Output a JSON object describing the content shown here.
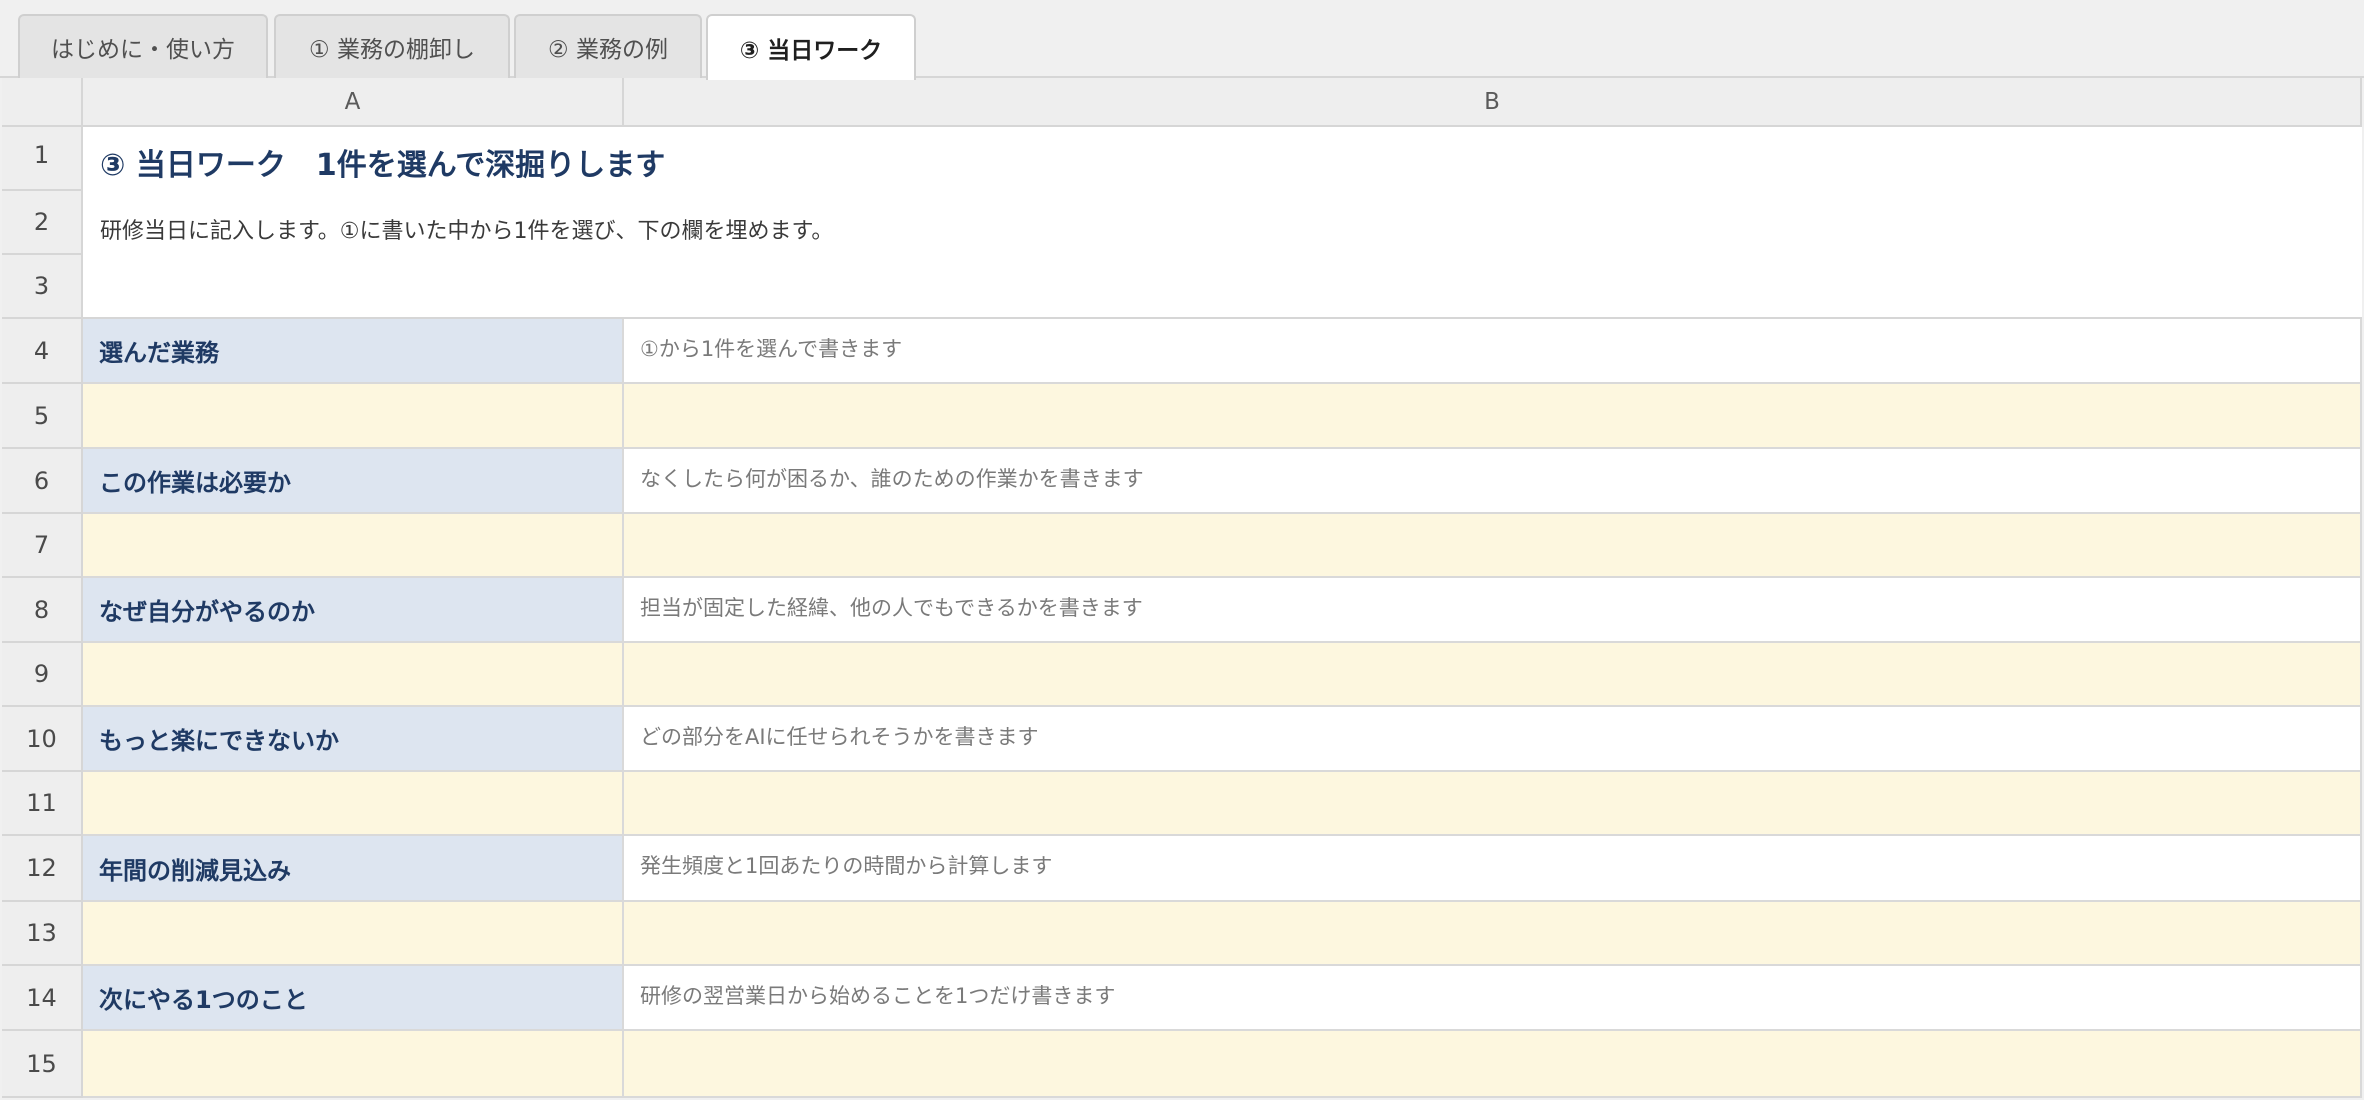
{
  "tabs": [
    {
      "label": "はじめに・使い方",
      "active": false
    },
    {
      "label": "① 業務の棚卸し",
      "active": false
    },
    {
      "label": "② 業務の例",
      "active": false
    },
    {
      "label": "③ 当日ワーク",
      "active": true
    }
  ],
  "columns": [
    "A",
    "B"
  ],
  "rows": [
    "1",
    "2",
    "3",
    "4",
    "5",
    "6",
    "7",
    "8",
    "9",
    "10",
    "11",
    "12",
    "13",
    "14",
    "15"
  ],
  "sheet": {
    "title": "③ 当日ワーク　1件を選んで深掘りします",
    "description": "研修当日に記入します。①に書いた中から1件を選び、下の欄を埋めます。",
    "items": [
      {
        "label": "選んだ業務",
        "hint": "①から1件を選んで書きます",
        "value": ""
      },
      {
        "label": "この作業は必要か",
        "hint": "なくしたら何が困るか、誰のための作業かを書きます",
        "value": ""
      },
      {
        "label": "なぜ自分がやるのか",
        "hint": "担当が固定した経緯、他の人でもできるかを書きます",
        "value": ""
      },
      {
        "label": "もっと楽にできないか",
        "hint": "どの部分をAIに任せられそうかを書きます",
        "value": ""
      },
      {
        "label": "年間の削減見込み",
        "hint": "発生頻度と1回あたりの時間から計算します",
        "value": ""
      },
      {
        "label": "次にやる1つのこと",
        "hint": "研修の翌営業日から始めることを1つだけ書きます",
        "value": ""
      }
    ]
  },
  "colors": {
    "label_bg": "#dde5f0",
    "label_text": "#1f3a64",
    "input_bg": "#fdf7df",
    "header_bg": "#eeeeee"
  }
}
